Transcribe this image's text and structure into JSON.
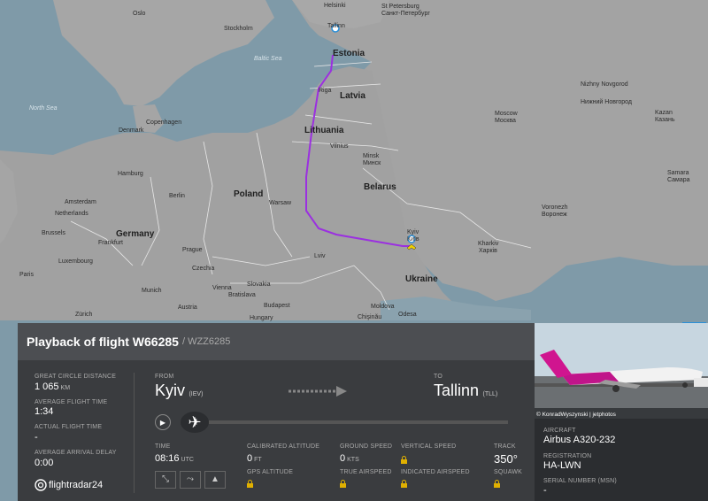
{
  "map": {
    "countries": [
      "Estonia",
      "Latvia",
      "Lithuania",
      "Poland",
      "Belarus",
      "Germany",
      "Ukraine",
      "Czechia",
      "Slovakia",
      "Hungary",
      "Moldova",
      "Denmark",
      "Netherlands",
      "Luxembourg",
      "Austria"
    ],
    "cities": [
      "Oslo",
      "Helsinki",
      "Stockholm",
      "St Petersburg",
      "Санкт-Петербург",
      "Tallinn",
      "Riga",
      "Copenhagen",
      "Vilnius",
      "Minsk",
      "Минск",
      "Hamburg",
      "Berlin",
      "Warsaw",
      "Amsterdam",
      "Brussels",
      "Frankfurt",
      "Prague",
      "Munich",
      "Vienna",
      "Bratislava",
      "Budapest",
      "Paris",
      "Kyiv",
      "Київ",
      "Kharkiv",
      "Харків",
      "Moscow",
      "Москва",
      "Nizhny Novgorod",
      "Нижний Новгород",
      "Kazan",
      "Казань",
      "Samara",
      "Самара",
      "Voronezh",
      "Воронеж",
      "Chişinău",
      "Odesa",
      "Lviv",
      "Zürich"
    ],
    "seas": [
      "Baltic Sea",
      "North Sea"
    ]
  },
  "panel": {
    "title": "Playback of flight W66285",
    "subtitle": "/ WZZ6285",
    "great_circle_label": "GREAT CIRCLE DISTANCE",
    "great_circle_value": "1 065",
    "great_circle_unit": "KM",
    "avg_flight_label": "AVERAGE FLIGHT TIME",
    "avg_flight_value": "1:34",
    "actual_flight_label": "ACTUAL FLIGHT TIME",
    "actual_flight_value": "-",
    "avg_delay_label": "AVERAGE ARRIVAL DELAY",
    "avg_delay_value": "0:00",
    "logo_text": "flightradar24",
    "from_label": "FROM",
    "from_city": "Kyiv",
    "from_code": "(IEV)",
    "to_label": "TO",
    "to_city": "Tallinn",
    "to_code": "(TLL)",
    "progress": 0.0,
    "time_label": "TIME",
    "time_value": "08:16",
    "time_unit": "UTC",
    "cal_alt_label": "CALIBRATED ALTITUDE",
    "cal_alt_value": "0",
    "cal_alt_unit": "FT",
    "gps_alt_label": "GPS ALTITUDE",
    "ground_speed_label": "GROUND SPEED",
    "ground_speed_value": "0",
    "ground_speed_unit": "KTS",
    "true_airspeed_label": "TRUE AIRSPEED",
    "vertical_speed_label": "VERTICAL SPEED",
    "indicated_airspeed_label": "INDICATED AIRSPEED",
    "track_label": "TRACK",
    "track_value": "350°",
    "squawk_label": "SQUAWK"
  },
  "side": {
    "photo_credit": "© KonradWyszynski | jetphotos",
    "aircraft_label": "AIRCRAFT",
    "aircraft_value": "Airbus A320-232",
    "registration_label": "REGISTRATION",
    "registration_value": "HA-LWN",
    "serial_label": "SERIAL NUMBER (MSN)",
    "serial_value": "-"
  },
  "close_icon": "close-icon",
  "colors": {
    "route": "#9b30e0",
    "accent": "#2a8fd8",
    "panel": "#3a3c3f",
    "header": "#4c4e52"
  }
}
